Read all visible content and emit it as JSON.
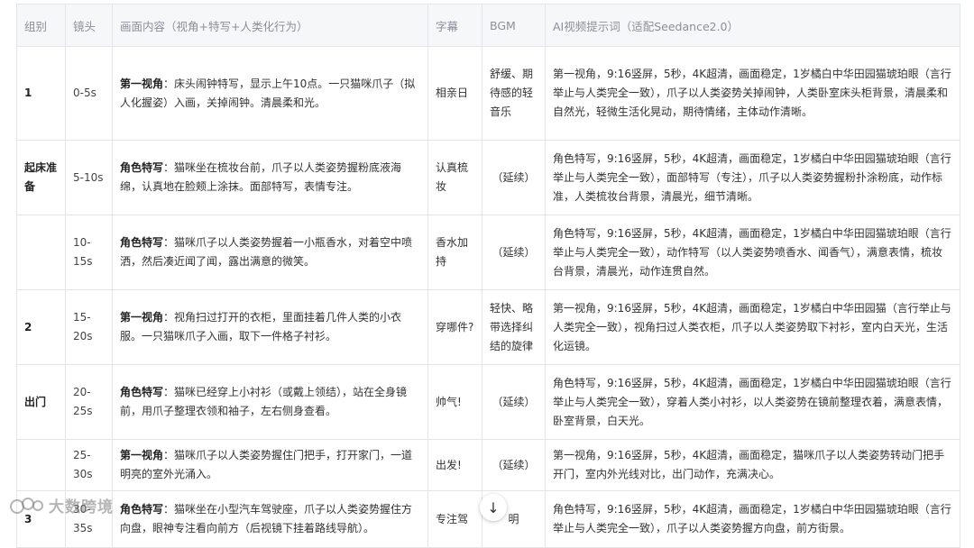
{
  "headers": [
    "组别",
    "镜头",
    "画面内容（视角+特写+人类化行为）",
    "字幕",
    "BGM",
    "AI视频提示词（适配Seedance2.0）"
  ],
  "rows": [
    {
      "group": "1",
      "lens": "0-5s",
      "scene_lead": "第一视角",
      "scene_text": "：床头闹钟特写，显示上午10点。一只猫咪爪子（拟人化握姿）入画，关掉闹钟。清晨柔和光。",
      "subtitle": "相亲日",
      "bgm": "舒缓、期待感的轻音乐",
      "ai": "第一视角，9:16竖屏，5秒，4K超清，画面稳定，1岁橘白中华田园猫琥珀眼（言行举止与人类完全一致），爪子以人类姿势关掉闹钟，人类卧室床头柜背景，清晨柔和自然光，轻微生活化晃动，期待情绪，主体动作清晰。"
    },
    {
      "group": "起床准备",
      "lens": "5-10s",
      "scene_lead": "角色特写",
      "scene_text": "：猫咪坐在梳妆台前，爪子以人类姿势握粉底液海绵，认真地在脸颊上涂抹。面部特写，表情专注。",
      "subtitle": "认真梳妆",
      "bgm": "（延续）",
      "ai": "角色特写，9:16竖屏，5秒，4K超清，画面稳定，1岁橘白中华田园猫琥珀眼（言行举止与人类完全一致），面部特写（专注），爪子以人类姿势握粉扑涂粉底，动作标准，人类梳妆台背景，清晨光，细节清晰。"
    },
    {
      "group": "",
      "lens": "10-15s",
      "scene_lead": "角色特写",
      "scene_text": "：猫咪爪子以人类姿势握着一小瓶香水，对着空中喷洒，然后凑近闻了闻，露出满意的微笑。",
      "subtitle": "香水加持",
      "bgm": "（延续）",
      "ai": "角色特写，9:16竖屏，5秒，4K超清，画面稳定，1岁橘白中华田园猫琥珀眼（言行举止与人类完全一致），动作特写（以人类姿势喷香水、闻香气），满意表情，梳妆台背景，清晨光，动作连贯自然。"
    },
    {
      "group": "2",
      "lens": "15-20s",
      "scene_lead": "第一视角",
      "scene_text": "：视角扫过打开的衣柜，里面挂着几件人类的小衣服。一只猫咪爪子入画，取下一件格子衬衫。",
      "subtitle": "穿哪件?",
      "bgm": "轻快、略带选择纠结的旋律",
      "ai": "第一视角，9:16竖屏，5秒，4K超清，画面稳定，1岁橘白中华田园猫（言行举止与人类完全一致），视角扫过人类衣柜，爪子以人类姿势取下衬衫，室内白天光，生活化运镜。"
    },
    {
      "group": "出门",
      "lens": "20-25s",
      "scene_lead": "角色特写",
      "scene_text": "：猫咪已经穿上小衬衫（或戴上领结），站在全身镜前，用爪子整理衣领和袖子，左右侧身查看。",
      "subtitle": "帅气!",
      "bgm": "（延续）",
      "ai": "角色特写，9:16竖屏，5秒，4K超清，画面稳定，1岁橘白中华田园猫琥珀眼（言行举止与人类完全一致），穿着人类小衬衫，以人类姿势在镜前整理衣着，满意表情，卧室背景，白天光。"
    },
    {
      "group": "",
      "lens": "25-30s",
      "scene_lead": "第一视角",
      "scene_text": "：猫咪爪子以人类姿势握住门把手，打开家门，一道明亮的室外光涌入。",
      "subtitle": "出发!",
      "bgm": "（延续）",
      "ai": "第一视角，9:16竖屏，5秒，4K超清，画面稳定，猫咪爪子以人类姿势转动门把手开门，室内外光线对比，出门动作，充满决心。"
    },
    {
      "group": "3",
      "lens": "30-35s",
      "scene_lead": "角色特写",
      "scene_text": "：猫咪坐在小型汽车驾驶座，爪子以人类姿势握住方向盘，眼神专注看向前方（后视镜下挂着路线导航）。",
      "subtitle": "专注驾",
      "bgm": "明",
      "ai": "角色特写，9:16竖屏，5秒，4K超清，画面稳定，1岁橘白中华田园猫琥珀眼（言行举止与人类完全一致），爪子以人类姿势握方向盘，前方街景。"
    }
  ],
  "watermark": "大数跨境",
  "scroll_button_icon": "arrow-down-icon"
}
